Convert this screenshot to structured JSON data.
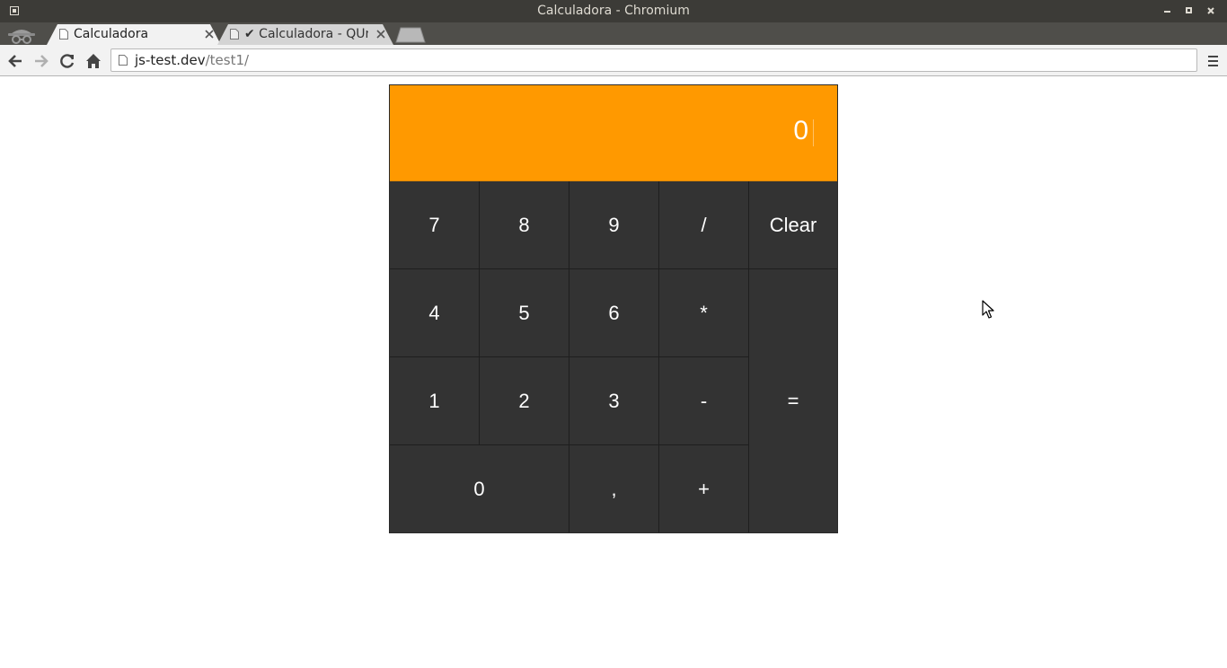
{
  "window": {
    "title": "Calculadora - Chromium"
  },
  "tabs": [
    {
      "label": "Calculadora",
      "active": true
    },
    {
      "label": "✔ Calculadora - QUnit",
      "active": false
    }
  ],
  "address_bar": {
    "host": "js-test.dev",
    "path": "/test1/"
  },
  "calculator": {
    "display": "0",
    "display_color": "#ff9900",
    "key_color": "#333333",
    "keys": {
      "k7": "7",
      "k8": "8",
      "k9": "9",
      "div": "/",
      "clear": "Clear",
      "k4": "4",
      "k5": "5",
      "k6": "6",
      "mul": "*",
      "k1": "1",
      "k2": "2",
      "k3": "3",
      "sub": "-",
      "k0": "0",
      "comma": ",",
      "add": "+",
      "eq": "="
    }
  }
}
